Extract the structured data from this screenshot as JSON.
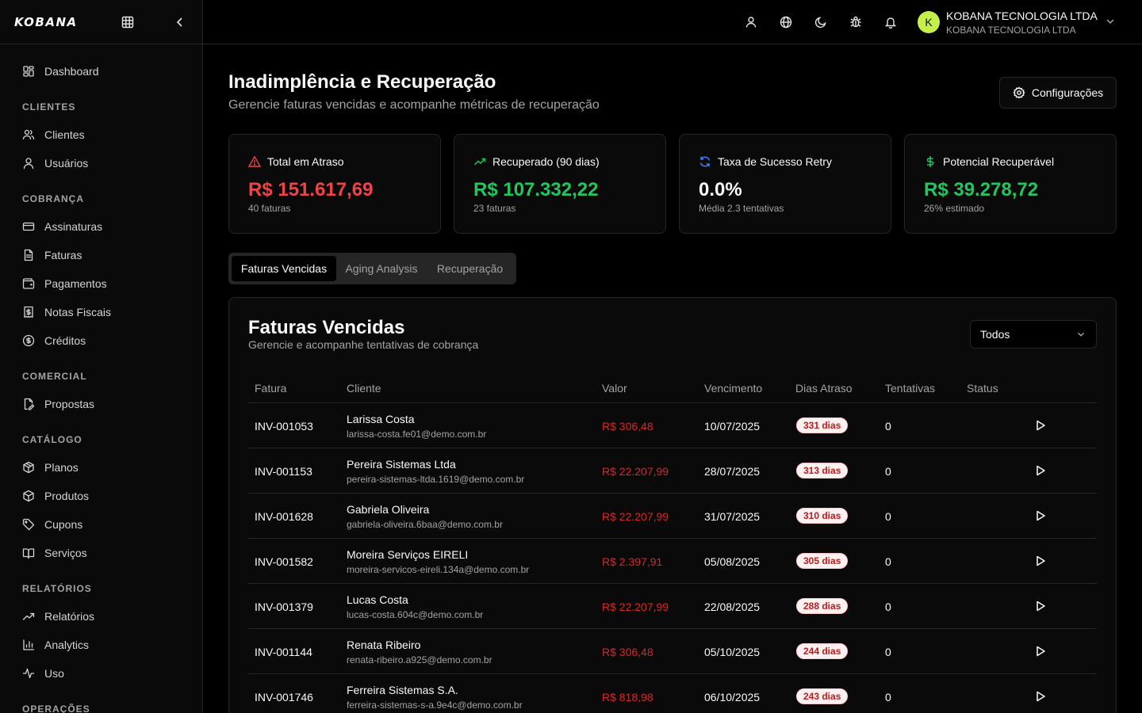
{
  "sidebar": {
    "logo": "KOBANA",
    "items": [
      {
        "type": "item",
        "label": "Dashboard",
        "icon": "dashboard-icon"
      },
      {
        "type": "section",
        "label": "CLIENTES"
      },
      {
        "type": "item",
        "label": "Clientes",
        "icon": "users-icon"
      },
      {
        "type": "item",
        "label": "Usuários",
        "icon": "user-icon"
      },
      {
        "type": "section",
        "label": "COBRANÇA"
      },
      {
        "type": "item",
        "label": "Assinaturas",
        "icon": "credit-card-icon"
      },
      {
        "type": "item",
        "label": "Faturas",
        "icon": "file-text-icon"
      },
      {
        "type": "item",
        "label": "Pagamentos",
        "icon": "wallet-icon"
      },
      {
        "type": "item",
        "label": "Notas Fiscais",
        "icon": "receipt-icon"
      },
      {
        "type": "item",
        "label": "Créditos",
        "icon": "coin-icon"
      },
      {
        "type": "section",
        "label": "COMERCIAL"
      },
      {
        "type": "item",
        "label": "Propostas",
        "icon": "file-signature-icon"
      },
      {
        "type": "section",
        "label": "CATÁLOGO"
      },
      {
        "type": "item",
        "label": "Planos",
        "icon": "package-icon"
      },
      {
        "type": "item",
        "label": "Produtos",
        "icon": "box-icon"
      },
      {
        "type": "item",
        "label": "Cupons",
        "icon": "tag-icon"
      },
      {
        "type": "item",
        "label": "Serviços",
        "icon": "book-icon"
      },
      {
        "type": "section",
        "label": "RELATÓRIOS"
      },
      {
        "type": "item",
        "label": "Relatórios",
        "icon": "trending-up-icon"
      },
      {
        "type": "item",
        "label": "Analytics",
        "icon": "bar-chart-icon"
      },
      {
        "type": "item",
        "label": "Uso",
        "icon": "activity-icon"
      },
      {
        "type": "section",
        "label": "OPERAÇÕES"
      }
    ]
  },
  "header": {
    "org_name": "KOBANA TECNOLOGIA LTDA",
    "org_sub": "KOBANA TECNOLOGIA LTDA",
    "avatar_initial": "K",
    "icons": [
      "user-icon",
      "globe-icon",
      "moon-icon",
      "bug-icon",
      "bell-icon"
    ]
  },
  "page": {
    "title": "Inadimplência e Recuperação",
    "subtitle": "Gerencie faturas vencidas e acompanhe métricas de recuperação",
    "config_label": "Configurações"
  },
  "cards": [
    {
      "label": "Total em Atraso",
      "value": "R$ 151.617,69",
      "sub": "40 faturas",
      "color": "#ef4444",
      "icon": "alert-triangle-icon"
    },
    {
      "label": "Recuperado (90 dias)",
      "value": "R$ 107.332,22",
      "sub": "23 faturas",
      "color": "#22c55e",
      "icon": "trending-up-icon"
    },
    {
      "label": "Taxa de Sucesso Retry",
      "value": "0.0%",
      "sub": "Média 2.3 tentativas",
      "color": "#fafafa",
      "icon": "refresh-icon"
    },
    {
      "label": "Potencial Recuperável",
      "value": "R$ 39.278,72",
      "sub": "26% estimado",
      "color": "#22c55e",
      "icon": "dollar-icon"
    }
  ],
  "tabs": [
    {
      "label": "Faturas Vencidas",
      "active": true
    },
    {
      "label": "Aging Analysis",
      "active": false
    },
    {
      "label": "Recuperação",
      "active": false
    }
  ],
  "panel": {
    "title": "Faturas Vencidas",
    "subtitle": "Gerencie e acompanhe tentativas de cobrança",
    "filter_value": "Todos"
  },
  "table": {
    "headers": [
      "Fatura",
      "Cliente",
      "Valor",
      "Vencimento",
      "Dias Atraso",
      "Tentativas",
      "Status"
    ],
    "rows": [
      {
        "invoice": "INV-001053",
        "name": "Larissa Costa",
        "email": "larissa-costa.fe01@demo.com.br",
        "value": "R$ 306,48",
        "due": "10/07/2025",
        "days": "331 dias",
        "attempts": "0"
      },
      {
        "invoice": "INV-001153",
        "name": "Pereira Sistemas Ltda",
        "email": "pereira-sistemas-ltda.1619@demo.com.br",
        "value": "R$ 22.207,99",
        "due": "28/07/2025",
        "days": "313 dias",
        "attempts": "0"
      },
      {
        "invoice": "INV-001628",
        "name": "Gabriela Oliveira",
        "email": "gabriela-oliveira.6baa@demo.com.br",
        "value": "R$ 22.207,99",
        "due": "31/07/2025",
        "days": "310 dias",
        "attempts": "0"
      },
      {
        "invoice": "INV-001582",
        "name": "Moreira Serviços EIRELI",
        "email": "moreira-servicos-eireli.134a@demo.com.br",
        "value": "R$ 2.397,91",
        "due": "05/08/2025",
        "days": "305 dias",
        "attempts": "0"
      },
      {
        "invoice": "INV-001379",
        "name": "Lucas Costa",
        "email": "lucas-costa.604c@demo.com.br",
        "value": "R$ 22.207,99",
        "due": "22/08/2025",
        "days": "288 dias",
        "attempts": "0"
      },
      {
        "invoice": "INV-001144",
        "name": "Renata Ribeiro",
        "email": "renata-ribeiro.a925@demo.com.br",
        "value": "R$ 306,48",
        "due": "05/10/2025",
        "days": "244 dias",
        "attempts": "0"
      },
      {
        "invoice": "INV-001746",
        "name": "Ferreira Sistemas S.A.",
        "email": "ferreira-sistemas-s-a.9e4c@demo.com.br",
        "value": "R$ 818,98",
        "due": "06/10/2025",
        "days": "243 dias",
        "attempts": "0"
      }
    ]
  }
}
